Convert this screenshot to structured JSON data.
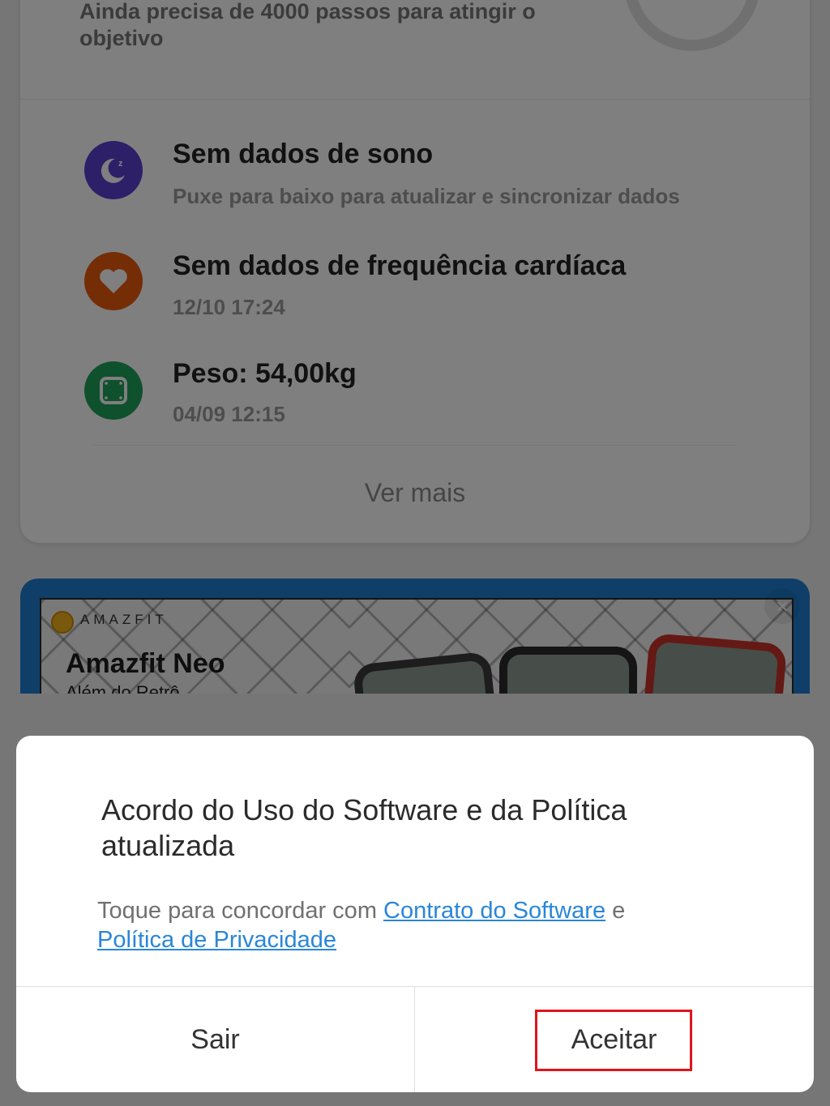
{
  "health_card": {
    "steps_message": "Ainda precisa de 4000 passos para atingir o objetivo",
    "rows": [
      {
        "title": "Sem dados de sono",
        "subtitle": "Puxe para baixo para atualizar e sincronizar dados",
        "icon": "sleep-moon-icon",
        "color": "#5b3fd1"
      },
      {
        "title": "Sem dados de frequência cardíaca",
        "subtitle": "12/10 17:24",
        "icon": "heart-icon",
        "color": "#ea5b0c"
      },
      {
        "title": "Peso: 54,00kg",
        "subtitle": "04/09 12:15",
        "icon": "scale-icon",
        "color": "#1fa35b"
      }
    ],
    "see_more": "Ver mais"
  },
  "banner": {
    "brand": "AMAZFIT",
    "title": "Amazfit Neo",
    "subtitle": "Além do Retrô",
    "close": "×"
  },
  "dialog": {
    "title": "Acordo do Uso do Software e da Política atualizada",
    "body_prefix": "Toque para concordar com ",
    "link_contract": "Contrato do Software",
    "body_join": " e ",
    "link_privacy": "Política de Privacidade",
    "button_exit": "Sair",
    "button_accept": "Aceitar",
    "highlight_color": "#e0141b"
  }
}
